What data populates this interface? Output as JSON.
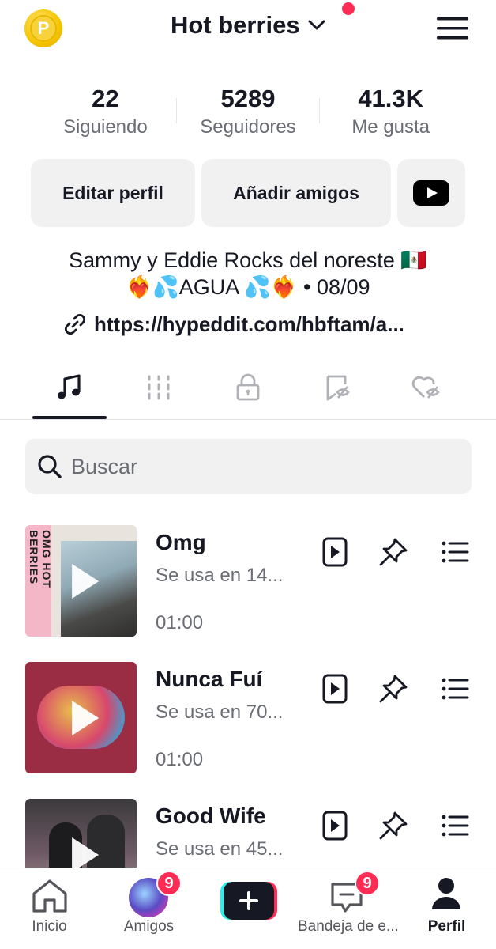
{
  "header": {
    "coin_letter": "P",
    "title": "Hot berries"
  },
  "stats": [
    {
      "value": "22",
      "label": "Siguiendo"
    },
    {
      "value": "5289",
      "label": "Seguidores"
    },
    {
      "value": "41.3K",
      "label": "Me gusta"
    }
  ],
  "buttons": {
    "edit": "Editar perfil",
    "add_friends": "Añadir amigos"
  },
  "bio": {
    "line1": "Sammy y Eddie Rocks del noreste 🇲🇽",
    "line2": "❤️‍🔥💦AGUA 💦❤️‍🔥 • 08/09",
    "link": "https://hypeddit.com/hbftam/a..."
  },
  "search": {
    "placeholder": "Buscar"
  },
  "songs": [
    {
      "title": "Omg",
      "usage": "Se usa en 14...",
      "duration": "01:00",
      "cover_text": "OMG HOT BERRIES"
    },
    {
      "title": "Nunca Fuí",
      "usage": "Se usa en 70...",
      "duration": "01:00"
    },
    {
      "title": "Good Wife",
      "usage": "Se usa en 45...",
      "duration": ""
    }
  ],
  "nav": {
    "home": "Inicio",
    "friends": "Amigos",
    "friends_badge": "9",
    "inbox": "Bandeja de e...",
    "inbox_badge": "9",
    "profile": "Perfil"
  },
  "colors": {
    "accent_red": "#fe2c55",
    "text_primary": "#161823",
    "text_secondary": "#6b6d75",
    "button_bg": "#f1f1f2"
  }
}
